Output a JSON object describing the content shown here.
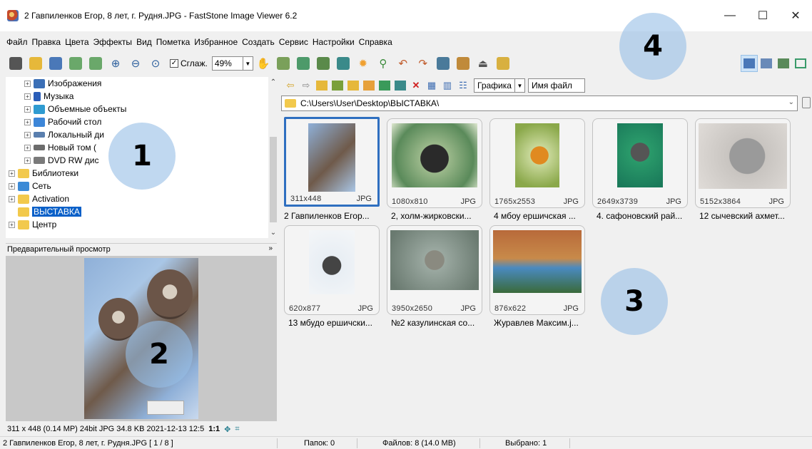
{
  "window": {
    "title": "2 Гавпиленков Егор, 8 лет, г. Рудня.JPG - FastStone Image Viewer 6.2",
    "minimize": "—",
    "maximize": "☐",
    "close": "✕"
  },
  "menu": [
    "Файл",
    "Правка",
    "Цвета",
    "Эффекты",
    "Вид",
    "Пометка",
    "Избранное",
    "Создать",
    "Сервис",
    "Настройки",
    "Справка"
  ],
  "toolbar": {
    "smooth_label": "Сглаж.",
    "smooth_checked": "✓",
    "zoom_value": "49%"
  },
  "tree": {
    "items": [
      {
        "label": "Изображения",
        "color": "#3b6fb6"
      },
      {
        "label": "Музыка",
        "color": "#2a5db8"
      },
      {
        "label": "Объемные объекты",
        "color": "#2f9bd1"
      },
      {
        "label": "Рабочий стол",
        "color": "#3d86d8"
      },
      {
        "label": "Локальный ди",
        "color": "#5a7fae"
      },
      {
        "label": "Новый том (",
        "color": "#6c6c6c"
      },
      {
        "label": "DVD RW дис",
        "color": "#7a7a7a"
      },
      {
        "label": "Библиотеки",
        "color": "#f2c94c"
      },
      {
        "label": "Сеть",
        "color": "#3b8ad6"
      },
      {
        "label": "Activation",
        "color": "#f2c94c"
      },
      {
        "label": "ВЫСТАВКА",
        "color": "#f2c94c"
      },
      {
        "label": "Центр",
        "color": "#f2c94c"
      }
    ]
  },
  "preview": {
    "header": "Предварительный просмотр",
    "info": "311 x 448 (0.14 MP)  24bit  JPG  34.8 KB  2021-12-13 12:5",
    "ratio": "1:1"
  },
  "nav": {
    "sort_type": "Графика",
    "sort_by": "Имя файл"
  },
  "path": "C:\\Users\\User\\Desktop\\ВЫСТАВКА\\",
  "thumbnails": [
    {
      "dim": "311x448",
      "ext": "JPG",
      "caption": "2 Гавпиленков Егор..."
    },
    {
      "dim": "1080x810",
      "ext": "JPG",
      "caption": "2, холм-жирковски..."
    },
    {
      "dim": "1765x2553",
      "ext": "JPG",
      "caption": "4 мбоу ершичская ..."
    },
    {
      "dim": "2649x3739",
      "ext": "JPG",
      "caption": "4. сафоновский рай..."
    },
    {
      "dim": "5152x3864",
      "ext": "JPG",
      "caption": "12 сычевский ахмет..."
    },
    {
      "dim": "620x877",
      "ext": "JPG",
      "caption": "13 мбудо ершичски..."
    },
    {
      "dim": "3950x2650",
      "ext": "JPG",
      "caption": "№2 казулинская со..."
    },
    {
      "dim": "876x622",
      "ext": "JPG",
      "caption": "Журавлев Максим.j..."
    }
  ],
  "markers": [
    "1",
    "2",
    "3",
    "4"
  ],
  "status": {
    "file": "2 Гавпиленков Егор, 8 лет, г. Рудня.JPG [ 1 / 8 ]",
    "folders": "Папок: 0",
    "files": "Файлов: 8 (14.0 MB)",
    "selected": "Выбрано: 1"
  },
  "colors": {
    "selection": "#0a60c8",
    "thumb_border_selected": "#2f6fc0",
    "marker_circle": "#a9cbea"
  }
}
